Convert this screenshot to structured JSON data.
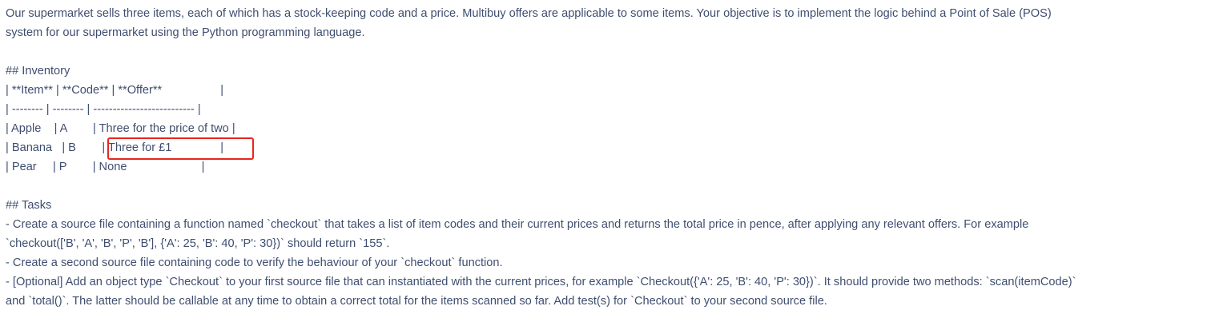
{
  "intro": {
    "line1": "Our supermarket sells three items, each of which has a stock-keeping code and a price. Multibuy offers are applicable to some items. Your objective is to implement the logic behind a Point of Sale (POS)",
    "line2": "system for our supermarket using the Python programming language."
  },
  "inventory": {
    "heading": "## Inventory",
    "header_row": "| **Item** | **Code** | **Offer**                  |",
    "divider_row": "| -------- | -------- | -------------------------- |",
    "rows": [
      "| Apple    | A        | Three for the price of two |",
      "| Banana   | B        | Three for £1               |",
      "| Pear     | P        | None                       |"
    ]
  },
  "tasks": {
    "heading": "## Tasks",
    "lines": [
      "- Create a source file containing a function named `checkout` that takes a list of item codes and their current prices and returns the total price in pence, after applying any relevant offers. For example",
      "`checkout(['B', 'A', 'B', 'P', 'B'], {'A': 25, 'B': 40, 'P': 30})` should return `155`.",
      "- Create a second source file containing code to verify the behaviour of your `checkout` function.",
      "- [Optional] Add an object type `Checkout` to your first source file that can instantiated with the current prices, for example `Checkout({'A': 25, 'B': 40, 'P': 30})`. It should provide two methods: `scan(itemCode)`",
      "and `total()`. The latter should be callable at any time to obtain a correct total for the items scanned so far. Add test(s) for `Checkout` to your second source file."
    ]
  },
  "annotation": {
    "highlight_color": "#e8251f",
    "highlighted_text": "| Three for £1               |"
  }
}
